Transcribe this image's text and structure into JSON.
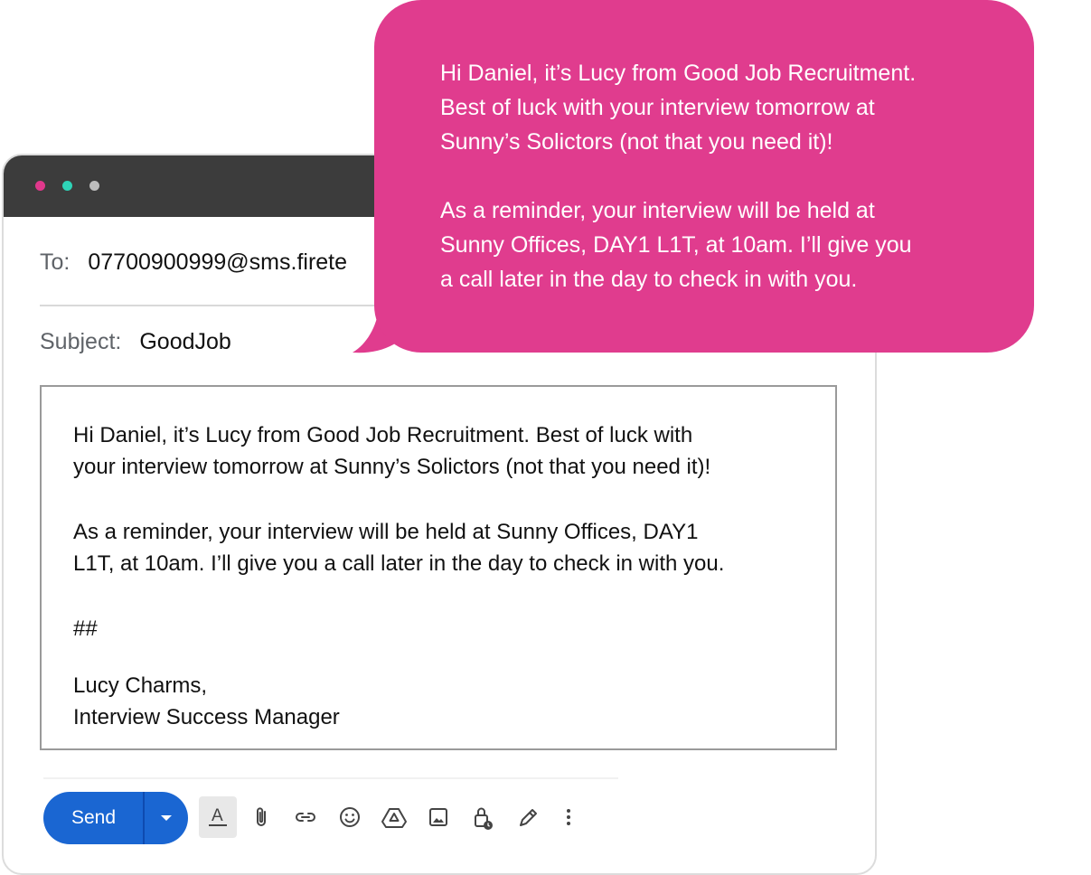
{
  "compose": {
    "to_label": "To:",
    "to_value": "07700900999@sms.firete",
    "subject_label": "Subject:",
    "subject_value": "GoodJob",
    "body": {
      "para1_line1": "Hi Daniel, it’s Lucy from Good Job Recruitment. Best of luck with",
      "para1_line2": "your interview tomorrow at Sunny’s Solictors (not that you need it)!",
      "para2_line1": "As a reminder, your interview will be held at Sunny Offices, DAY1",
      "para2_line2": "L1T, at 10am. I’ll give you a call later in the day to check in with you.",
      "separator": "##",
      "signature_name": "Lucy Charms,",
      "signature_title": "Interview Success Manager"
    },
    "send_label": "Send"
  },
  "sms_bubble": {
    "line1": "Hi Daniel, it’s Lucy from Good Job Recruitment.",
    "line2": "Best of luck with your interview tomorrow at",
    "line3": "Sunny’s Solictors (not that you need it)!",
    "line4": "As a reminder, your interview will be held at",
    "line5": "Sunny Offices, DAY1 L1T, at 10am. I’ll give you",
    "line6": "a call later in the day to check in with you."
  },
  "toolbar_icons": [
    "text-format-icon",
    "attach-icon",
    "link-icon",
    "emoji-icon",
    "drive-icon",
    "image-icon",
    "confidential-lock-icon",
    "signature-pen-icon",
    "more-options-icon"
  ],
  "colors": {
    "bubble": "#e03c8e",
    "send_button": "#1a66d2",
    "titlebar": "#3c3c3c",
    "dot_pink": "#e0388c",
    "dot_teal": "#2ed3b7",
    "dot_grey": "#bdbdbd"
  }
}
